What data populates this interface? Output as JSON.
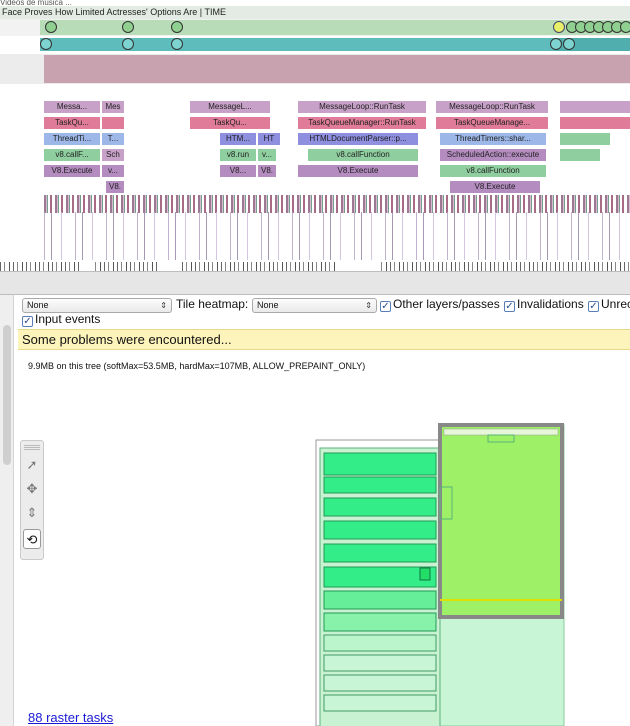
{
  "timeline": {
    "top_text": "Videos de musica ...",
    "frame_title": "Face Proves How Limited Actresses' Options Are | TIME",
    "flame_rows": [
      [
        "Messa...",
        "Mes",
        "MessageL...",
        "MessageLoop::RunTask",
        "MessageLoop::RunTask"
      ],
      [
        "TaskQu...",
        "TaskQu...",
        "TaskQueueManager::RunTask",
        "TaskQueueManage..."
      ],
      [
        "ThreadTi...",
        "T...",
        "HTM...",
        "HT",
        "HTMLDocumentParser::p...",
        "ThreadTimers::shar..."
      ],
      [
        "v8.callF...",
        "Sch",
        "v8.run",
        "v...",
        "v8.callFunction",
        "ScheduledAction::execute"
      ],
      [
        "V8.Execute",
        "v...",
        "V8...",
        "V8.",
        "V8.Execute",
        "v8.callFunction"
      ],
      [
        "V8.",
        "V8.Execute"
      ]
    ]
  },
  "controls": {
    "layer_select": "None",
    "tile_heatmap_label": "Tile heatmap:",
    "tile_heatmap_select": "None",
    "other_layers_label": "Other layers/passes",
    "invalidations_label": "Invalidations",
    "unrecorded_label": "Unrec",
    "input_events_label": "Input events"
  },
  "warning": "Some problems were encountered...",
  "memory_text": "9.9MB on this tree (softMax=53.5MB, hardMax=107MB, ALLOW_PREPAINT_ONLY)",
  "raster_link": "88 raster tasks",
  "colors": {
    "warning_bg": "#fdf4bc",
    "layer_green": "#9ef066",
    "tile_green": "#33ee88",
    "link": "#1a1ad6"
  },
  "tools": [
    "select-icon",
    "pan-icon",
    "zoom-icon",
    "rotate-icon"
  ]
}
